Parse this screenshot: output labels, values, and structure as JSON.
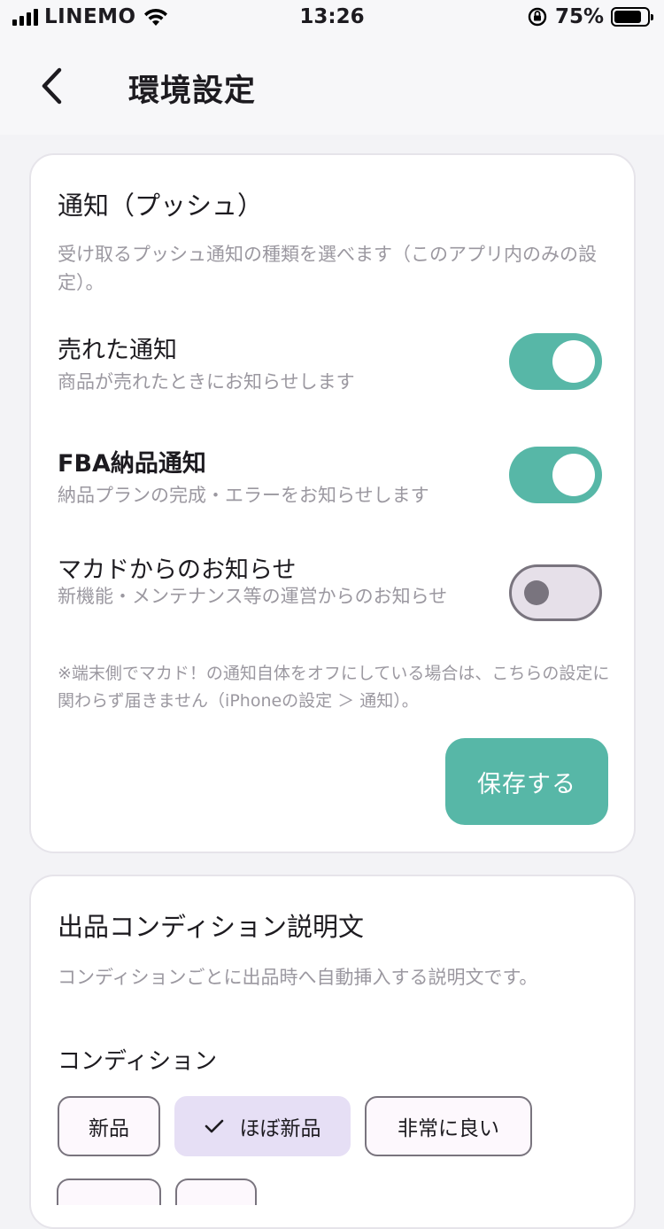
{
  "status_bar": {
    "carrier": "LINEMO",
    "time": "13:26",
    "battery_percent": "75%",
    "icons": [
      "signal-icon",
      "wifi-icon",
      "orientation-lock-icon",
      "battery-icon"
    ]
  },
  "header": {
    "title": "環境設定",
    "back_icon": "chevron-left-icon"
  },
  "notifications_card": {
    "title": "通知（プッシュ）",
    "description": "受け取るプッシュ通知の種類を選べます（このアプリ内のみの設定）。",
    "settings": [
      {
        "title": "売れた通知",
        "subtitle": "商品が売れたときにお知らせします",
        "enabled": true
      },
      {
        "title": "FBA納品通知",
        "subtitle": "納品プランの完成・エラーをお知らせします",
        "enabled": true
      },
      {
        "title": "マカドからのお知らせ",
        "subtitle": "新機能・メンテナンス等の運営からのお知らせ",
        "enabled": false
      }
    ],
    "note": "※端末側でマカド！の通知自体をオフにしている場合は、こちらの設定に関わらず届きません（iPhoneの設定 ＞ 通知）。",
    "save_label": "保存する"
  },
  "condition_card": {
    "title": "出品コンディション説明文",
    "description": "コンディションごとに出品時へ自動挿入する説明文です。",
    "condition_label": "コンディション",
    "chips": [
      {
        "label": "新品",
        "selected": false
      },
      {
        "label": "ほぼ新品",
        "selected": true
      },
      {
        "label": "非常に良い",
        "selected": false
      }
    ]
  },
  "colors": {
    "accent": "#57b7a7",
    "selected_chip": "#e6dff5",
    "muted_text": "#9b98a0",
    "outline": "#79747e"
  }
}
